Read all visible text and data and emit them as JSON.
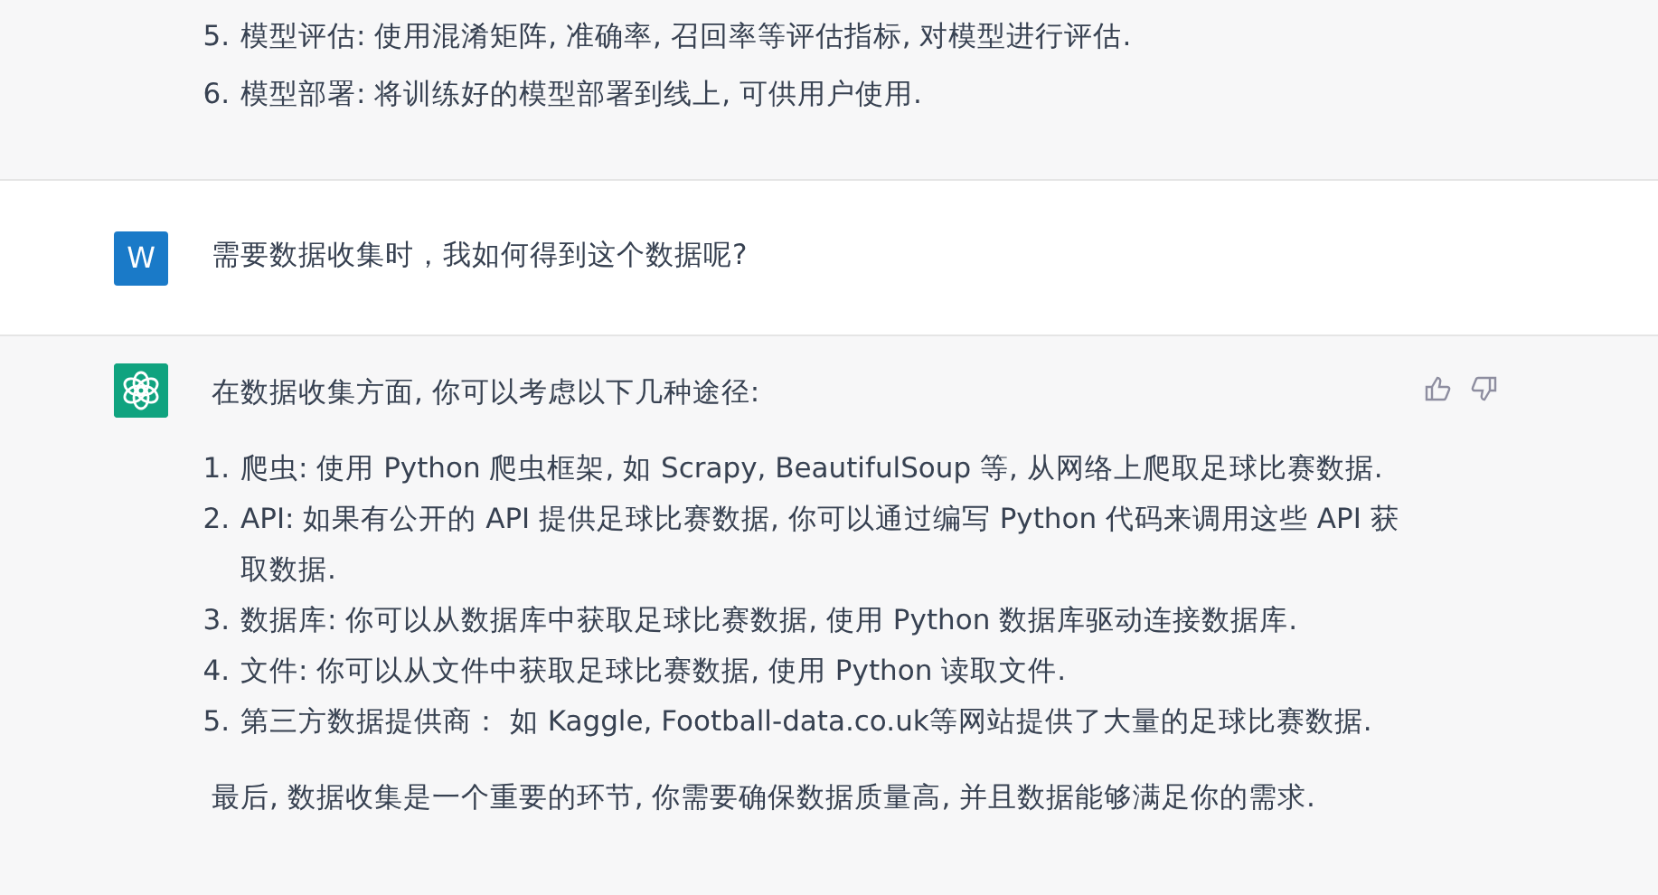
{
  "messages": [
    {
      "kind": "assistant_tail",
      "items": [
        {
          "number": "5.",
          "text": "模型评估: 使用混淆矩阵, 准确率, 召回率等评估指标, 对模型进行评估."
        },
        {
          "number": "6.",
          "text": "模型部署: 将训练好的模型部署到线上, 可供用户使用."
        }
      ]
    },
    {
      "kind": "user",
      "avatar": "W",
      "text": "需要数据收集时，我如何得到这个数据呢?"
    },
    {
      "kind": "assistant",
      "intro": "在数据收集方面, 你可以考虑以下几种途径:",
      "items": [
        {
          "number": "1.",
          "text": "爬虫: 使用 Python 爬虫框架, 如 Scrapy, BeautifulSoup 等, 从网络上爬取足球比赛数据."
        },
        {
          "number": "2.",
          "text": "API: 如果有公开的 API 提供足球比赛数据, 你可以通过编写 Python 代码来调用这些 API 获取数据."
        },
        {
          "number": "3.",
          "text": "数据库: 你可以从数据库中获取足球比赛数据, 使用 Python 数据库驱动连接数据库."
        },
        {
          "number": "4.",
          "text": "文件: 你可以从文件中获取足球比赛数据, 使用 Python 读取文件."
        },
        {
          "number": "5.",
          "text": "第三方数据提供商：  如 Kaggle, Football-data.co.uk等网站提供了大量的足球比赛数据."
        }
      ],
      "outro": "最后, 数据收集是一个重要的环节, 你需要确保数据质量高, 并且数据能够满足你的需求."
    }
  ]
}
